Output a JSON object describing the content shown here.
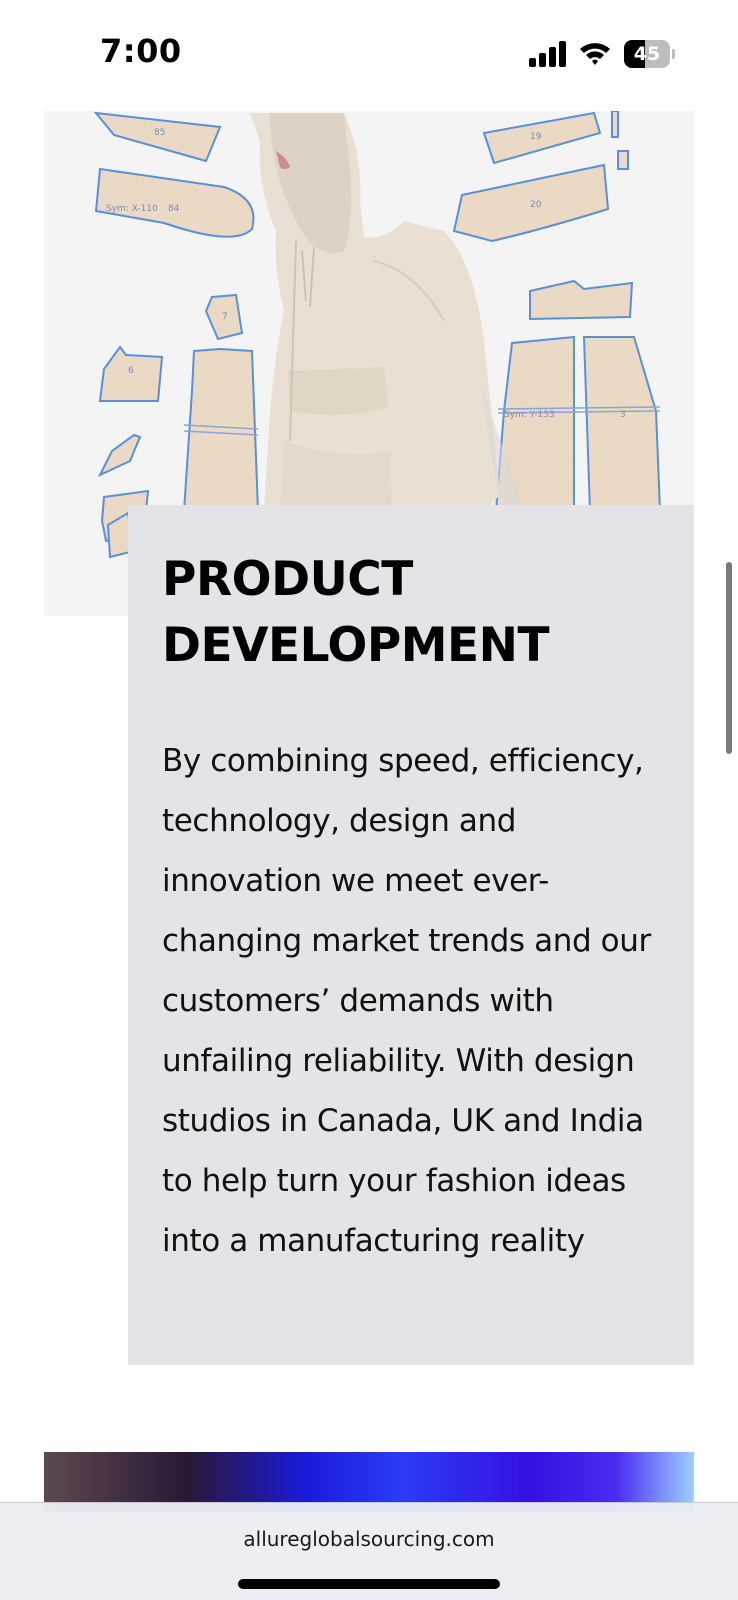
{
  "status_bar": {
    "time": "7:00",
    "battery_level": "45",
    "battery_fraction": 0.45,
    "icons": [
      "signal-icon",
      "wifi-icon",
      "battery-icon"
    ]
  },
  "hero": {
    "image_description_icon": "garment-pattern-hoodie-image"
  },
  "card": {
    "title_line1": "PRODUCT",
    "title_line2": "DEVELOPMENT",
    "body": "By combining speed, efficiency, technology, design and innovation we meet ever-changing market trends and our customers’ demands with unfailing reliability. With design studios in Canada, UK and India to help turn your fashion ideas into a manufacturing reality"
  },
  "browser": {
    "url": "allureglobalsourcing.com"
  },
  "colors": {
    "card_background": "#e4e3e7",
    "pattern_fill": "#ead9c4",
    "pattern_stroke": "#5b8fd6",
    "jacket": "#e9e0d3"
  }
}
